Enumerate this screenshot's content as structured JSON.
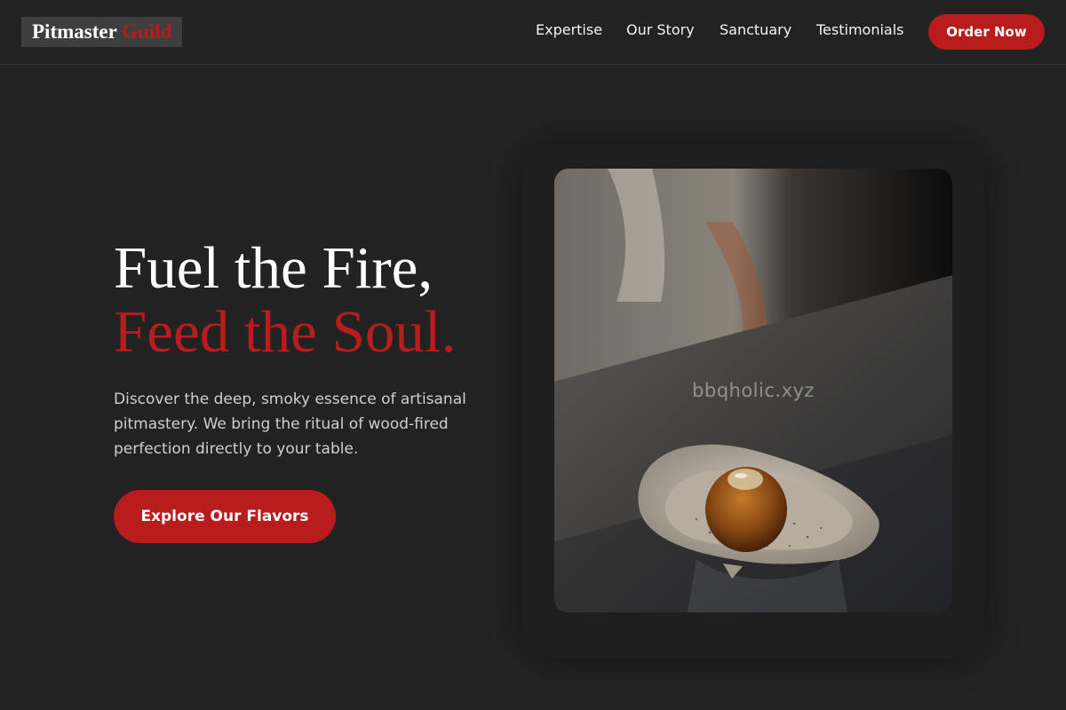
{
  "header": {
    "logo_main": "Pitmaster",
    "logo_accent": "Guild",
    "nav": [
      "Expertise",
      "Our Story",
      "Sanctuary",
      "Testimonials"
    ],
    "cta_label": "Order Now"
  },
  "hero": {
    "title_line1": "Fuel the Fire,",
    "title_line2": "Feed the Soul.",
    "description": "Discover the deep, smoky essence of artisanal pitmastery. We bring the ritual of wood-fired perfection directly to your table.",
    "button_label": "Explore Our Flavors"
  },
  "image": {
    "subject": "smoked-bite-on-ceramic-shell-dish",
    "watermark": "bbqholic.xyz"
  },
  "colors": {
    "background": "#222222",
    "accent": "#b91c1c",
    "text": "#ffffff",
    "muted_text": "#cfcfcf"
  }
}
